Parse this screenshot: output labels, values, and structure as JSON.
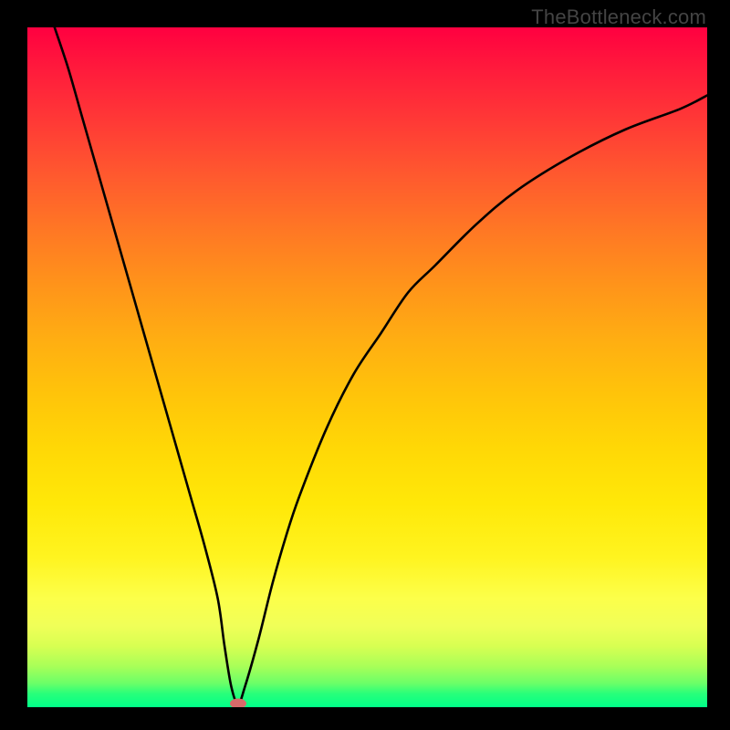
{
  "watermark": "TheBottleneck.com",
  "chart_data": {
    "type": "line",
    "title": "",
    "xlabel": "",
    "ylabel": "",
    "xlim": [
      0,
      100
    ],
    "ylim": [
      0,
      100
    ],
    "grid": false,
    "legend": false,
    "background_gradient": {
      "direction": "vertical",
      "stops": [
        {
          "pos": 0.0,
          "color": "#ff0040"
        },
        {
          "pos": 0.5,
          "color": "#ffc000"
        },
        {
          "pos": 0.85,
          "color": "#fcff4a"
        },
        {
          "pos": 1.0,
          "color": "#00ff88"
        }
      ]
    },
    "series": [
      {
        "name": "bottleneck-curve",
        "color": "#000000",
        "stroke_width": 2.5,
        "x": [
          4,
          6,
          8,
          10,
          12,
          14,
          16,
          18,
          20,
          22,
          24,
          26,
          28,
          29,
          30,
          31,
          32,
          34,
          36,
          38,
          40,
          44,
          48,
          52,
          56,
          60,
          66,
          72,
          80,
          88,
          96,
          100
        ],
        "y": [
          100,
          94,
          87,
          80,
          73,
          66,
          59,
          52,
          45,
          38,
          31,
          24,
          16,
          9,
          3,
          0.5,
          3,
          10,
          18,
          25,
          31,
          41,
          49,
          55,
          61,
          65,
          71,
          76,
          81,
          85,
          88,
          90
        ]
      }
    ],
    "markers": [
      {
        "name": "min-point",
        "x": 31,
        "y": 0.5,
        "color": "#d86a6a",
        "shape": "ellipse"
      }
    ]
  }
}
